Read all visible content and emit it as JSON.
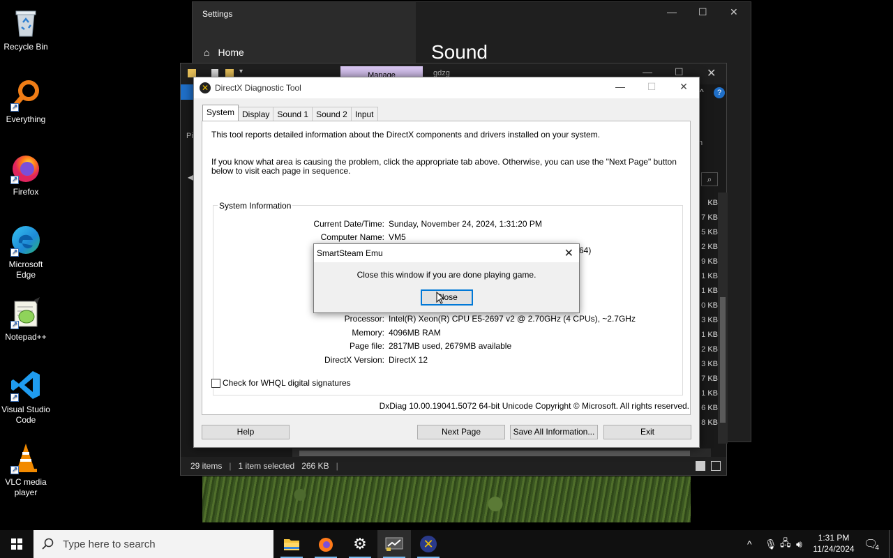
{
  "desktop": {
    "icons": [
      {
        "label": "Recycle Bin"
      },
      {
        "label": "Everything"
      },
      {
        "label": "Firefox"
      },
      {
        "label": "Microsoft Edge"
      },
      {
        "label": "Notepad++"
      },
      {
        "label": "Visual Studio Code"
      },
      {
        "label": "VLC media player"
      }
    ]
  },
  "settings": {
    "title": "Settings",
    "home": "Home",
    "page_title": "Sound"
  },
  "explorer": {
    "manage": "Manage",
    "tab_fragment": "gdzg",
    "status_items": "29 items",
    "status_selected": "1 item selected",
    "status_size": "266 KB",
    "sizes": [
      "KB",
      "7 KB",
      "5 KB",
      "2 KB",
      "9 KB",
      "1 KB",
      "1 KB",
      "0 KB",
      "3 KB",
      "1 KB",
      "2 KB",
      "3 KB",
      "7 KB",
      "1 KB",
      "6 KB",
      "8 KB"
    ],
    "side_fragment_left": "Pi",
    "side_fragment_right": "n"
  },
  "dxdiag": {
    "title": "DirectX Diagnostic Tool",
    "tabs": [
      "System",
      "Display",
      "Sound 1",
      "Sound 2",
      "Input"
    ],
    "intro1": "This tool reports detailed information about the DirectX components and drivers installed on your system.",
    "intro2": "If you know what area is causing the problem, click the appropriate tab above.  Otherwise, you can use the \"Next Page\" button below to visit each page in sequence.",
    "group_label": "System Information",
    "rows_top": [
      {
        "key": "Current Date/Time:",
        "value": "Sunday, November 24, 2024, 1:31:20 PM"
      },
      {
        "key": "Computer Name:",
        "value": "VM5"
      }
    ],
    "partial_fragment": "64)",
    "rows_bottom": [
      {
        "key": "Processor:",
        "value": "Intel(R) Xeon(R) CPU E5-2697 v2 @ 2.70GHz (4 CPUs), ~2.7GHz"
      },
      {
        "key": "Memory:",
        "value": "4096MB RAM"
      },
      {
        "key": "Page file:",
        "value": "2817MB used, 2679MB available"
      },
      {
        "key": "DirectX Version:",
        "value": "DirectX 12"
      }
    ],
    "whql": "Check for WHQL digital signatures",
    "footer": "DxDiag 10.00.19041.5072 64-bit Unicode  Copyright © Microsoft. All rights reserved.",
    "buttons": {
      "help": "Help",
      "next": "Next Page",
      "save": "Save All Information...",
      "exit": "Exit"
    }
  },
  "smartsteam": {
    "title": "SmartSteam Emu",
    "message": "Close this window if you are done playing game.",
    "close": "Close"
  },
  "taskbar": {
    "search_placeholder": "Type here to search",
    "time": "1:31 PM",
    "date": "11/24/2024",
    "notification_count": "4"
  }
}
